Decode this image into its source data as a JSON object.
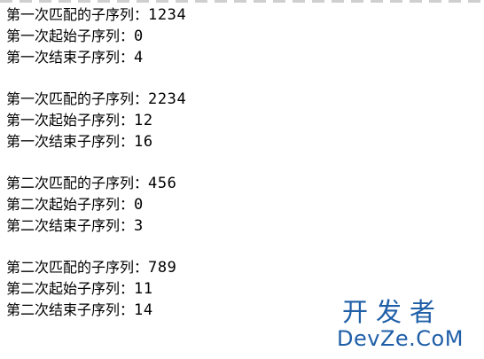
{
  "output": {
    "blocks": [
      {
        "lines": [
          {
            "label": "第一次匹配的子序列：",
            "value": "1234"
          },
          {
            "label": "第一次起始子序列：",
            "value": "0"
          },
          {
            "label": "第一次结束子序列：",
            "value": "4"
          }
        ]
      },
      {
        "lines": [
          {
            "label": "第一次匹配的子序列：",
            "value": "2234"
          },
          {
            "label": "第一次起始子序列：",
            "value": "12"
          },
          {
            "label": "第一次结束子序列：",
            "value": "16"
          }
        ]
      },
      {
        "lines": [
          {
            "label": "第二次匹配的子序列：",
            "value": "456"
          },
          {
            "label": "第二次起始子序列：",
            "value": "0"
          },
          {
            "label": "第二次结束子序列：",
            "value": "3"
          }
        ]
      },
      {
        "lines": [
          {
            "label": "第二次匹配的子序列：",
            "value": "789"
          },
          {
            "label": "第二次起始子序列：",
            "value": "11"
          },
          {
            "label": "第二次结束子序列：",
            "value": "14"
          }
        ]
      }
    ]
  },
  "watermark": {
    "chinese": "开发者",
    "english": "DevZe.CoM",
    "color": "#1f5fa8"
  }
}
